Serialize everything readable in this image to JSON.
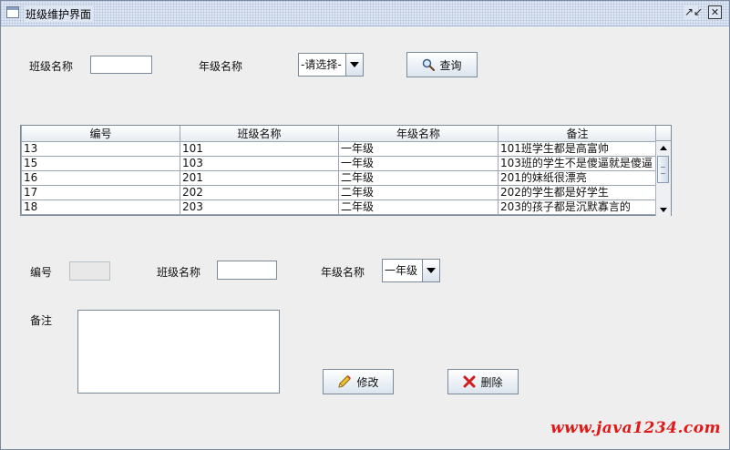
{
  "window": {
    "title": "班级维护界面"
  },
  "search": {
    "class_name_label": "班级名称",
    "class_name_value": "",
    "grade_label": "年级名称",
    "grade_selected": "-请选择-",
    "query_button": "查询"
  },
  "table": {
    "columns": [
      "编号",
      "班级名称",
      "年级名称",
      "备注"
    ],
    "rows": [
      [
        "13",
        "101",
        "一年级",
        "101班学生都是高富帅"
      ],
      [
        "15",
        "103",
        "一年级",
        "103班的学生不是傻逼就是傻逼"
      ],
      [
        "16",
        "201",
        "二年级",
        "201的妹纸很漂亮"
      ],
      [
        "17",
        "202",
        "二年级",
        "202的学生都是好学生"
      ],
      [
        "18",
        "203",
        "二年级",
        "203的孩子都是沉默寡言的"
      ]
    ]
  },
  "form": {
    "id_label": "编号",
    "id_value": "",
    "class_name_label": "班级名称",
    "class_name_value": "",
    "grade_label": "年级名称",
    "grade_selected": "一年级",
    "remark_label": "备注",
    "remark_value": "",
    "modify_button": "修改",
    "delete_button": "删除"
  },
  "watermark": "www.java1234.com",
  "icons": {
    "window": "window-icon",
    "restore": "restore-icon",
    "close": "close-icon",
    "query": "magnifier-icon",
    "modify": "pencil-icon",
    "delete": "red-x-icon"
  },
  "colors": {
    "watermark": "#e01818",
    "titlebar": "#dde6f2"
  }
}
